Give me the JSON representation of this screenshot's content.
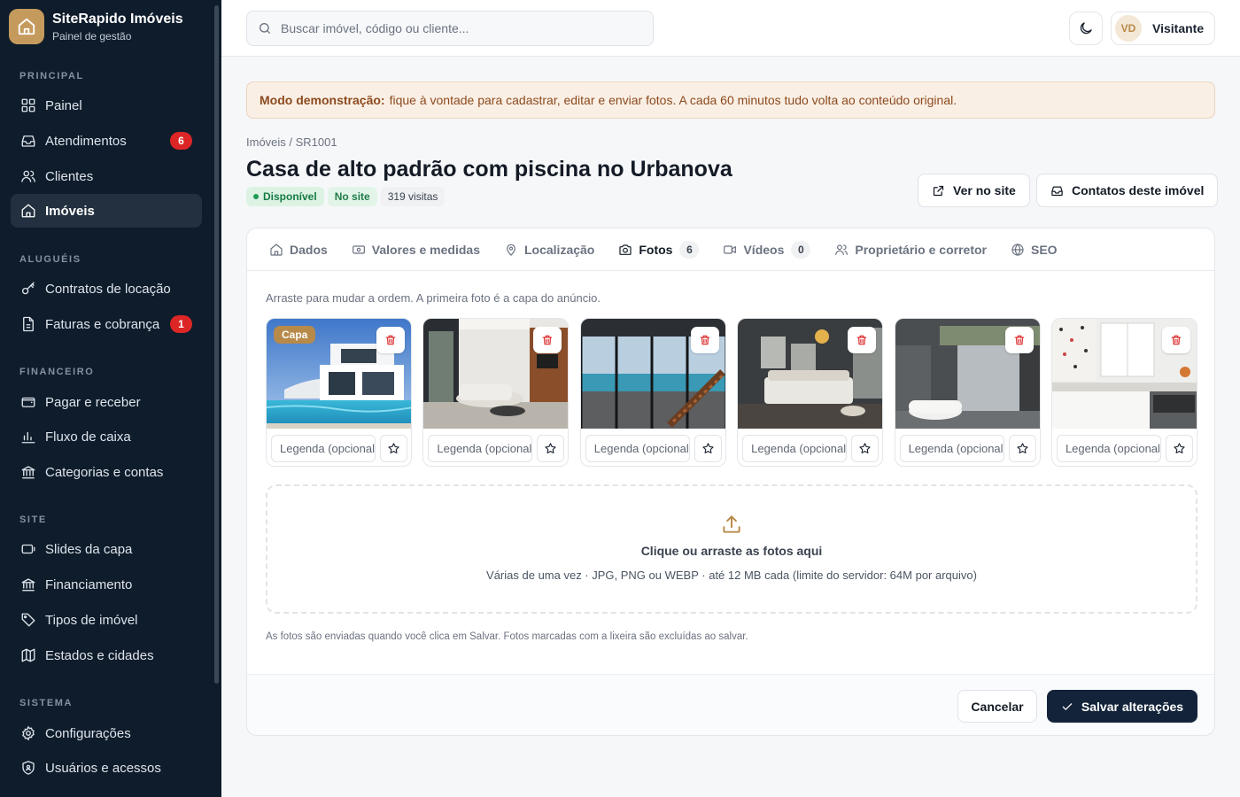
{
  "brand": {
    "name": "SiteRapido Imóveis",
    "subtitle": "Painel de gestão"
  },
  "sidebar": {
    "sections": [
      {
        "title": "PRINCIPAL",
        "items": [
          {
            "label": "Painel",
            "icon": "dashboard-icon"
          },
          {
            "label": "Atendimentos",
            "icon": "inbox-icon",
            "badge": "6"
          },
          {
            "label": "Clientes",
            "icon": "users-icon"
          },
          {
            "label": "Imóveis",
            "icon": "home-icon",
            "active": true
          }
        ]
      },
      {
        "title": "ALUGUÉIS",
        "items": [
          {
            "label": "Contratos de locação",
            "icon": "key-icon"
          },
          {
            "label": "Faturas e cobrança",
            "icon": "invoice-icon",
            "badge": "1"
          }
        ]
      },
      {
        "title": "FINANCEIRO",
        "items": [
          {
            "label": "Pagar e receber",
            "icon": "wallet-icon"
          },
          {
            "label": "Fluxo de caixa",
            "icon": "bar-chart-icon"
          },
          {
            "label": "Categorias e contas",
            "icon": "bank-icon"
          }
        ]
      },
      {
        "title": "SITE",
        "items": [
          {
            "label": "Slides da capa",
            "icon": "slides-icon"
          },
          {
            "label": "Financiamento",
            "icon": "bank-icon"
          },
          {
            "label": "Tipos de imóvel",
            "icon": "tag-icon"
          },
          {
            "label": "Estados e cidades",
            "icon": "map-icon"
          }
        ]
      },
      {
        "title": "SISTEMA",
        "items": [
          {
            "label": "Configurações",
            "icon": "gear-icon"
          },
          {
            "label": "Usuários e acessos",
            "icon": "shield-icon"
          }
        ]
      }
    ]
  },
  "topbar": {
    "search_placeholder": "Buscar imóvel, código ou cliente...",
    "user_initials": "VD",
    "user_name": "Visitante"
  },
  "notice": {
    "strong": "Modo demonstração:",
    "text": "fique à vontade para cadastrar, editar e enviar fotos. A cada 60 minutos tudo volta ao conteúdo original."
  },
  "page": {
    "breadcrumb": "Imóveis / SR1001",
    "title": "Casa de alto padrão com piscina no Urbanova",
    "status": "Disponível",
    "site_status": "No site",
    "visits": "319 visitas",
    "view_button": "Ver no site",
    "contacts_button": "Contatos deste imóvel"
  },
  "tabs": [
    {
      "label": "Dados",
      "icon": "home-icon"
    },
    {
      "label": "Valores e medidas",
      "icon": "money-icon"
    },
    {
      "label": "Localização",
      "icon": "pin-icon"
    },
    {
      "label": "Fotos",
      "icon": "camera-icon",
      "count": "6",
      "active": true
    },
    {
      "label": "Vídeos",
      "icon": "video-icon",
      "count": "0"
    },
    {
      "label": "Proprietário e corretor",
      "icon": "users-icon"
    },
    {
      "label": "SEO",
      "icon": "globe-icon"
    }
  ],
  "photos": {
    "hint": "Arraste para mudar a ordem. A primeira foto é a capa do anúncio.",
    "cover_label": "Capa",
    "caption_placeholder": "Legenda (opcional)",
    "items": [
      {
        "scene": "exterior-pool"
      },
      {
        "scene": "living-room"
      },
      {
        "scene": "glass-stairs"
      },
      {
        "scene": "bedroom"
      },
      {
        "scene": "bathroom"
      },
      {
        "scene": "kitchen"
      }
    ]
  },
  "dropzone": {
    "title": "Clique ou arraste as fotos aqui",
    "subtitle": "Várias de uma vez · JPG, PNG ou WEBP · até 12 MB cada (limite do servidor: 64M por arquivo)"
  },
  "footnote": "As fotos são enviadas quando você clica em Salvar. Fotos marcadas com a lixeira são excluídas ao salvar.",
  "actions": {
    "cancel": "Cancelar",
    "save": "Salvar alterações"
  },
  "colors": {
    "sidebar": "#0f1c2b",
    "accent": "#b88a49",
    "primary": "#13243a",
    "danger": "#dc2626"
  }
}
